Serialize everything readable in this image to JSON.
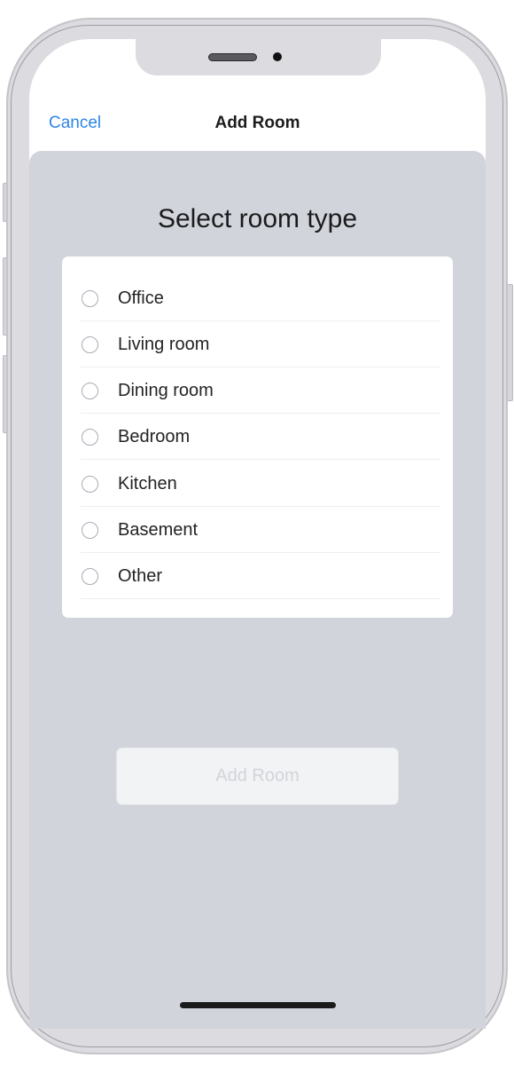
{
  "nav": {
    "cancel_label": "Cancel",
    "title": "Add Room"
  },
  "main": {
    "heading": "Select room type",
    "options": [
      {
        "label": "Office",
        "selected": false
      },
      {
        "label": "Living room",
        "selected": false
      },
      {
        "label": "Dining room",
        "selected": false
      },
      {
        "label": "Bedroom",
        "selected": false
      },
      {
        "label": "Kitchen",
        "selected": false
      },
      {
        "label": "Basement",
        "selected": false
      },
      {
        "label": "Other",
        "selected": false
      }
    ],
    "submit_label": "Add Room",
    "submit_enabled": false
  },
  "colors": {
    "accent": "#2f86e4",
    "sheet_background": "#d1d4db",
    "disabled_text": "#d2d4da"
  }
}
